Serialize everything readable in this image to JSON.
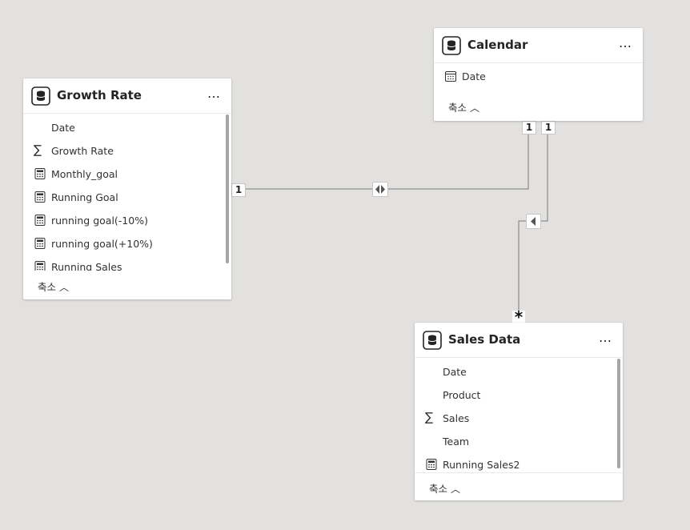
{
  "theme": {
    "canvas_bg": "#e2e1df",
    "card_bg": "#ffffff",
    "line_color": "#7a7a7a"
  },
  "tables": {
    "growth_rate": {
      "title": "Growth Rate",
      "more": "…",
      "collapse_label": "축소",
      "fields": [
        {
          "label": "Date",
          "icon": "none"
        },
        {
          "label": "Growth Rate",
          "icon": "sigma-icon"
        },
        {
          "label": "Monthly_goal",
          "icon": "calculator-icon"
        },
        {
          "label": "Running Goal",
          "icon": "calculator-icon"
        },
        {
          "label": "running goal(-10%)",
          "icon": "calculator-icon"
        },
        {
          "label": "running goal(+10%)",
          "icon": "calculator-icon"
        },
        {
          "label": "Running Sales",
          "icon": "calculator-icon"
        }
      ]
    },
    "calendar": {
      "title": "Calendar",
      "more": "…",
      "collapse_label": "축소",
      "fields": [
        {
          "label": "Date",
          "icon": "calendar-icon"
        }
      ]
    },
    "sales_data": {
      "title": "Sales Data",
      "more": "…",
      "collapse_label": "축소",
      "fields": [
        {
          "label": "Date",
          "icon": "none"
        },
        {
          "label": "Product",
          "icon": "none"
        },
        {
          "label": "Sales",
          "icon": "sigma-icon"
        },
        {
          "label": "Team",
          "icon": "none"
        },
        {
          "label": "Running Sales2",
          "icon": "calculator-icon"
        }
      ]
    }
  },
  "relationships": {
    "growth_calendar": {
      "from_cardinality": "1",
      "to_cardinality": "1",
      "direction": "both"
    },
    "calendar_sales": {
      "from_cardinality": "1",
      "to_cardinality": "*",
      "direction": "single"
    }
  }
}
